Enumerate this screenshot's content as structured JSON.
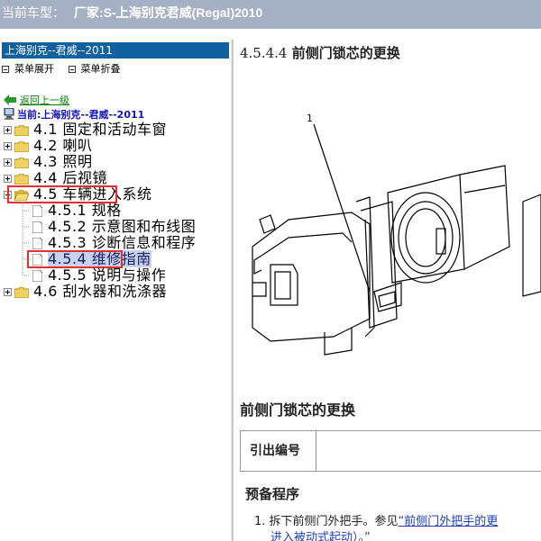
{
  "titlebar": {
    "prefix": "当前车型：",
    "maker_label": "厂家:S-上海别克君威(Regal)2010"
  },
  "sidebar": {
    "header": "上海别克--君威--2011",
    "expand_all": "菜单展开",
    "collapse_all": "菜单折叠",
    "back": "返回上一级",
    "current": "当前:上海别克--君威--2011",
    "items": [
      {
        "label": "4.1 固定和活动车窗",
        "expanded": false
      },
      {
        "label": "4.2 喇叭",
        "expanded": false
      },
      {
        "label": "4.3 照明",
        "expanded": false
      },
      {
        "label": "4.4 后视镜",
        "expanded": false
      },
      {
        "label": "4.5 车辆进入系统",
        "expanded": true,
        "children": [
          {
            "label": "4.5.1 规格"
          },
          {
            "label": "4.5.2 示意图和布线图"
          },
          {
            "label": "4.5.3 诊断信息和程序"
          },
          {
            "label": "4.5.4 维修指南",
            "selected": true
          },
          {
            "label": "4.5.5 说明与操作"
          }
        ]
      },
      {
        "label": "4.6 刮水器和洗涤器",
        "expanded": false
      }
    ]
  },
  "content": {
    "heading_number": "4.5.4.4",
    "heading_text": "前侧门锁芯的更换",
    "figure_callout": "1",
    "section_title": "前侧门锁芯的更换",
    "table_header": "引出编号",
    "pre_title": "预备程序",
    "step1_prefix": "1. 拆下前侧门外把手。参见",
    "step1_link": "“前侧门外把手的更",
    "step1_cont": "进入被动式起动）。”"
  },
  "colors": {
    "titlebar_bg": "#a5b0c4",
    "sidebar_header_bg": "#1160a0",
    "highlight": "#e03030",
    "link": "#1e40c0",
    "back_link": "#008000"
  }
}
